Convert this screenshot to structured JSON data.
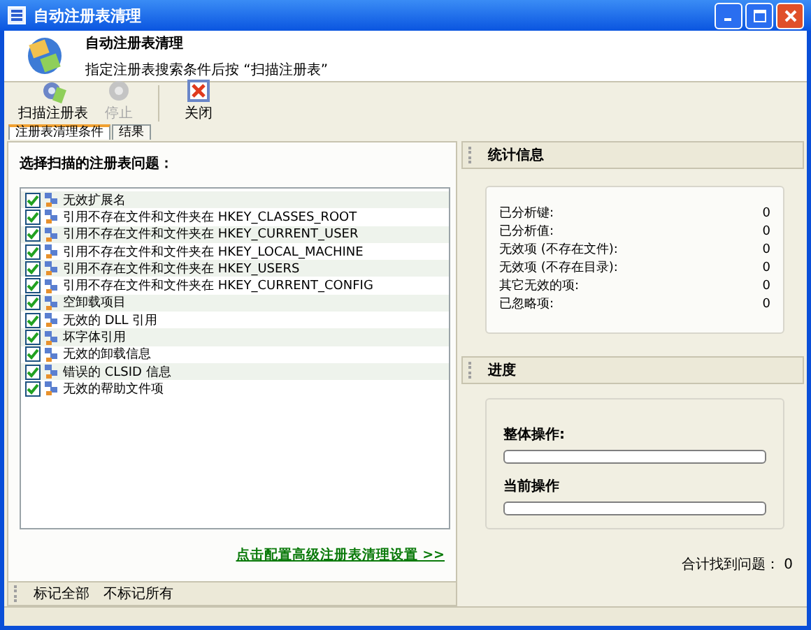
{
  "window": {
    "title": "自动注册表清理"
  },
  "header": {
    "title": "自动注册表清理",
    "subtitle": "指定注册表搜索条件后按 “扫描注册表”"
  },
  "toolbar": [
    {
      "label": "扫描注册表",
      "kind": "scan",
      "disabled": false
    },
    {
      "label": "停止",
      "kind": "stop",
      "disabled": true
    },
    {
      "label": "关闭",
      "kind": "close",
      "disabled": false
    }
  ],
  "tabs": [
    {
      "label": "注册表清理条件",
      "selected": true
    },
    {
      "label": "结果",
      "selected": false
    }
  ],
  "scan_list": {
    "heading": "选择扫描的注册表问题：",
    "items": [
      {
        "label": "无效扩展名",
        "checked": true
      },
      {
        "label": "引用不存在文件和文件夹在 HKEY_CLASSES_ROOT",
        "checked": true
      },
      {
        "label": "引用不存在文件和文件夹在 HKEY_CURRENT_USER",
        "checked": true
      },
      {
        "label": "引用不存在文件和文件夹在 HKEY_LOCAL_MACHINE",
        "checked": true
      },
      {
        "label": "引用不存在文件和文件夹在 HKEY_USERS",
        "checked": true
      },
      {
        "label": "引用不存在文件和文件夹在 HKEY_CURRENT_CONFIG",
        "checked": true
      },
      {
        "label": "空卸载项目",
        "checked": true
      },
      {
        "label": "无效的 DLL 引用",
        "checked": true
      },
      {
        "label": "坏字体引用",
        "checked": true
      },
      {
        "label": "无效的卸载信息",
        "checked": true
      },
      {
        "label": "错误的 CLSID 信息",
        "checked": true
      },
      {
        "label": "无效的帮助文件项",
        "checked": true
      }
    ],
    "link": "点击配置高级注册表清理设置 >>"
  },
  "bottom_bar": [
    "标记全部",
    "不标记所有"
  ],
  "statistics": {
    "title": "统计信息",
    "rows": [
      {
        "label": "已分析键:",
        "value": "0"
      },
      {
        "label": "已分析值:",
        "value": "0"
      },
      {
        "label": "无效项 (不存在文件):",
        "value": "0"
      },
      {
        "label": "无效项 (不存在目录):",
        "value": "0"
      },
      {
        "label": "其它无效的项:",
        "value": "0"
      },
      {
        "label": "已忽略项:",
        "value": "0"
      }
    ]
  },
  "progress": {
    "title": "进度",
    "bars": [
      {
        "label": "整体操作:",
        "level": 0
      },
      {
        "label": "当前操作",
        "level": 0
      }
    ],
    "total": "合计找到问题： 0"
  }
}
